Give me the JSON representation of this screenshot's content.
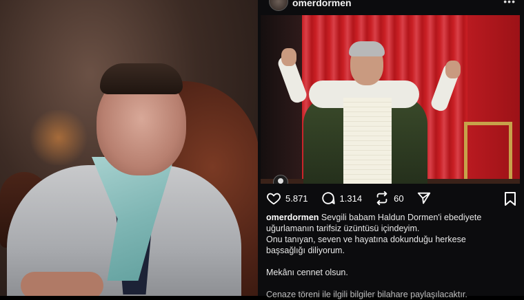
{
  "post": {
    "username": "omerdormen",
    "more_label": "•••",
    "likes": "5.871",
    "comments": "1.314",
    "reposts": "60",
    "caption_lines": [
      "Sevgili babam Haldun Dormen'i ebediyete",
      "uğurlamanın tarifsiz üzüntüsü içindeyim.",
      "Onu tanıyan, seven ve hayatına dokunduğu herkese",
      "başsağlığı diliyorum.",
      "Mekânı cennet olsun.",
      "Cenaze töreni ile ilgili bilgiler bilahare paylaşılacaktır."
    ]
  },
  "icons": {
    "like": "heart-icon",
    "comment": "comment-icon",
    "repost": "repost-icon",
    "share": "send-icon",
    "save": "bookmark-icon",
    "tag": "user-tag-icon"
  },
  "colors": {
    "background": "#0c0c0e",
    "text": "#ffffff",
    "curtain_red": "#c41d22",
    "frame_gold": "#c7a24a"
  }
}
